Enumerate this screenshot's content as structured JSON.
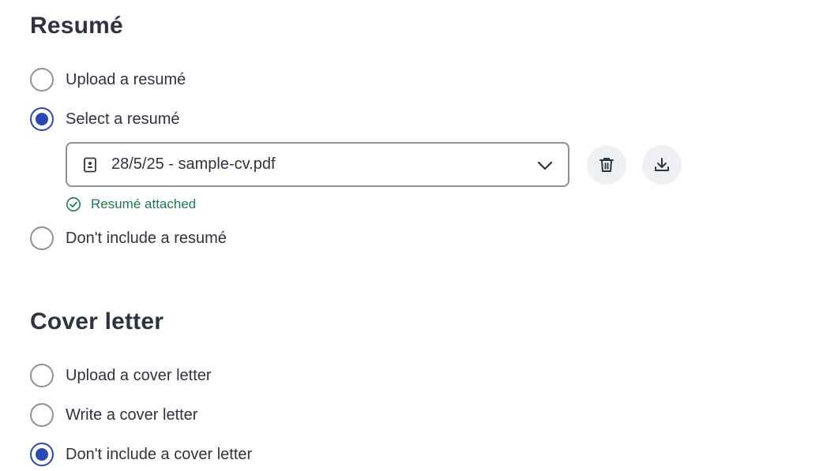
{
  "resume": {
    "title": "Resumé",
    "options": [
      {
        "label": "Upload a resumé",
        "checked": false
      },
      {
        "label": "Select a resumé",
        "checked": true
      },
      {
        "label": "Don't include a resumé",
        "checked": false
      }
    ],
    "selected_file": "28/5/25 - sample-cv.pdf",
    "status_text": "Resumé attached",
    "icons": {
      "file": "file-icon",
      "dropdown": "chevron-down-icon",
      "delete": "trash-icon",
      "download": "download-icon",
      "status": "check-circle-icon"
    },
    "colors": {
      "accent": "#2b47b5",
      "success": "#1b7a4b"
    }
  },
  "cover_letter": {
    "title": "Cover letter",
    "options": [
      {
        "label": "Upload a cover letter",
        "checked": false
      },
      {
        "label": "Write a cover letter",
        "checked": false
      },
      {
        "label": "Don't include a cover letter",
        "checked": true
      }
    ]
  }
}
